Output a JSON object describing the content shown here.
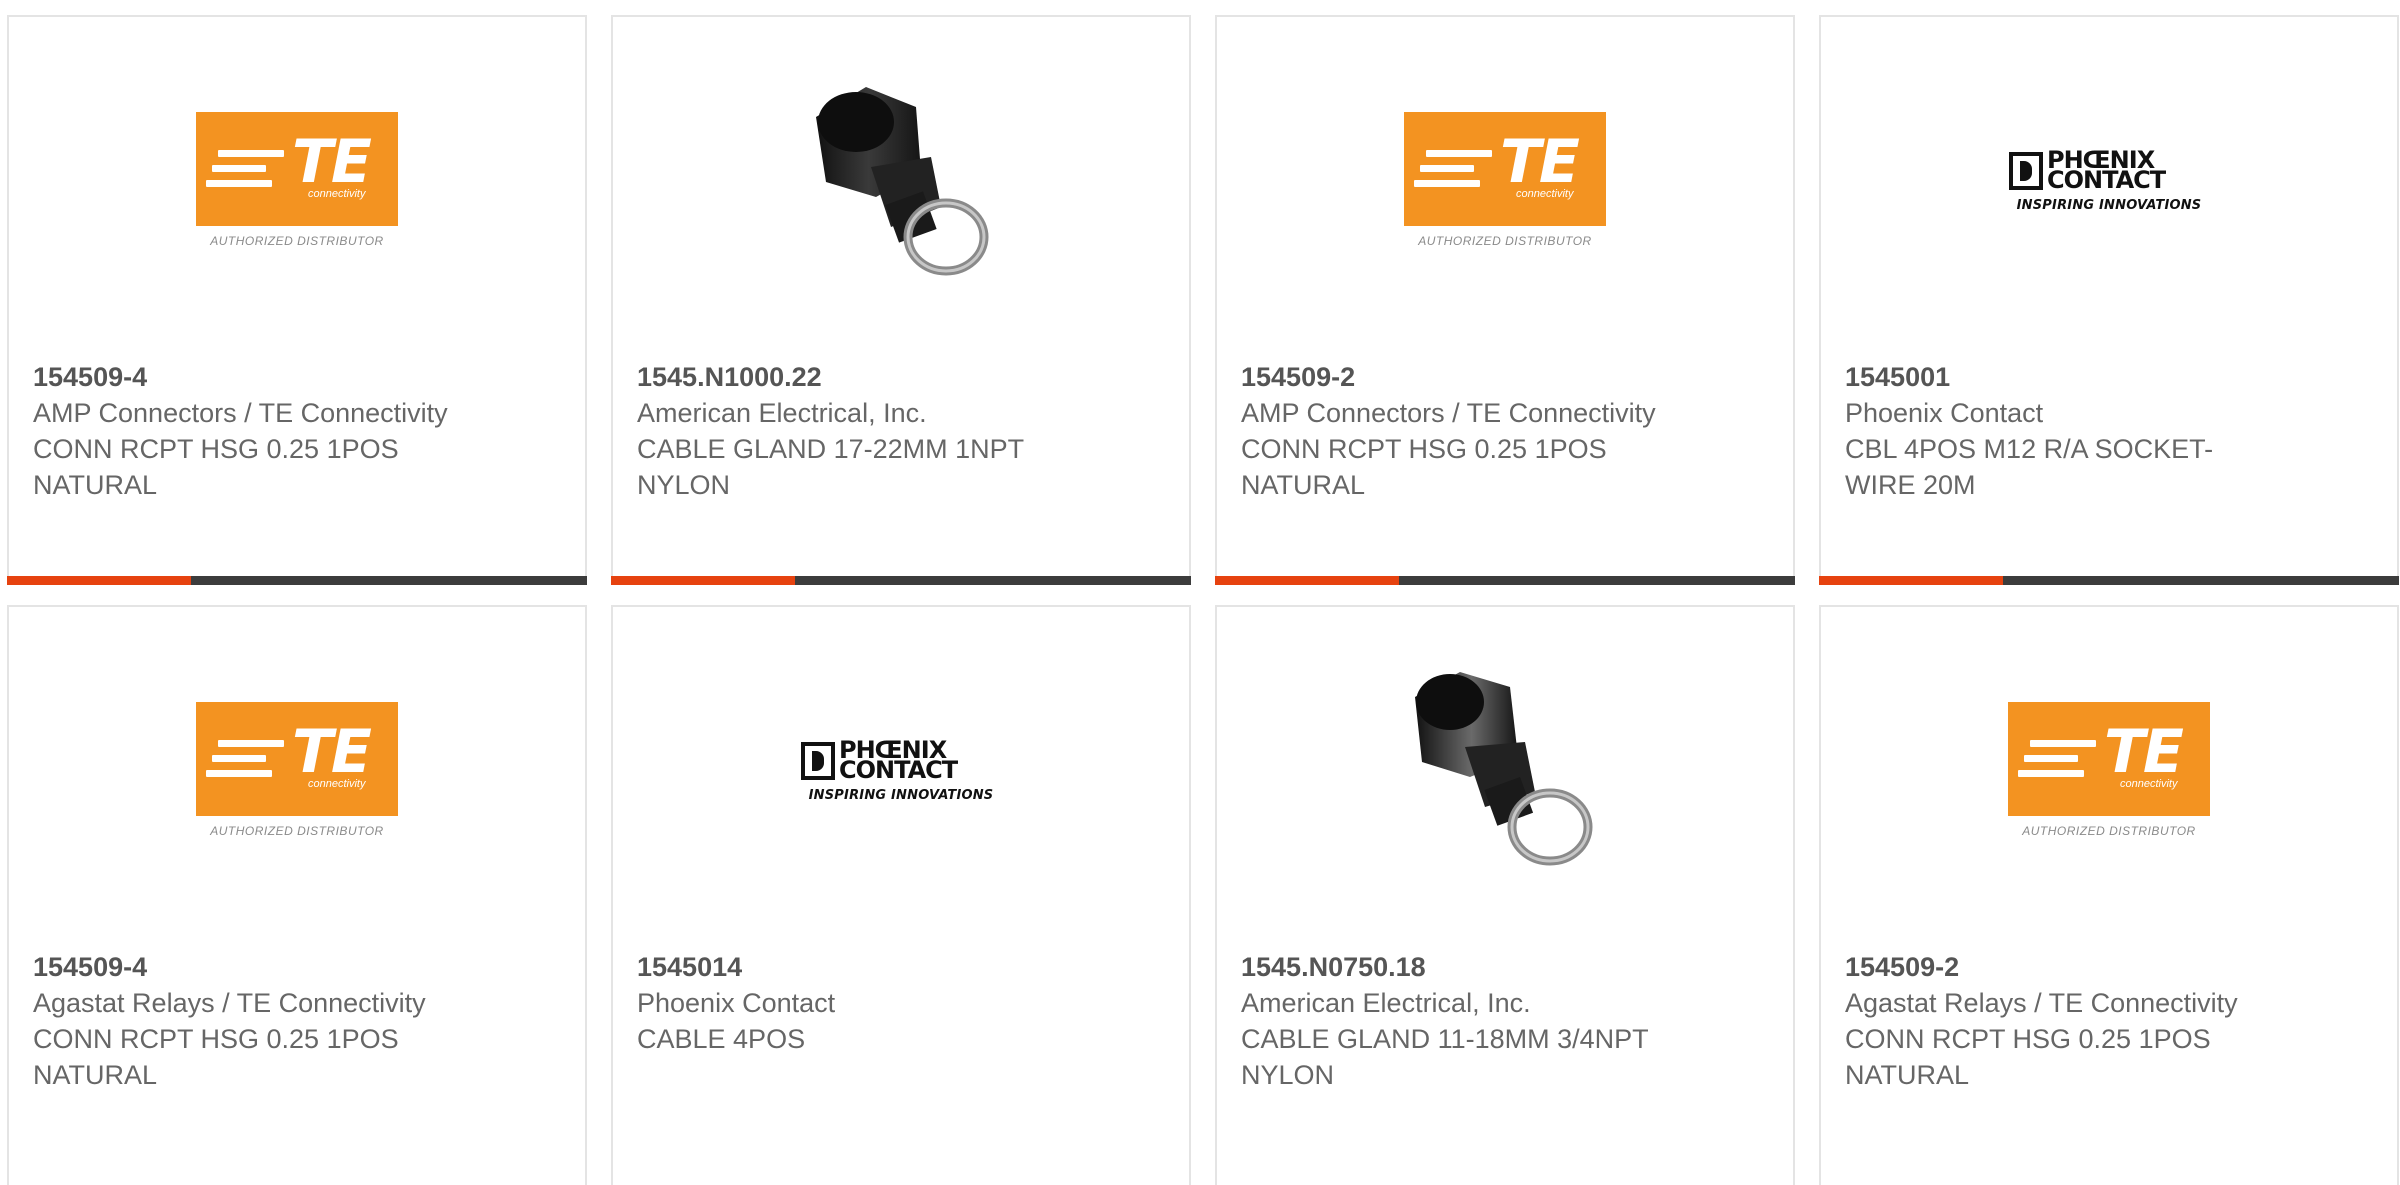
{
  "products": [
    {
      "part_number": "154509-4",
      "manufacturer": "AMP Connectors / TE Connectivity",
      "description": "CONN RCPT HSG 0.25 1POS NATURAL",
      "image": "te-logo"
    },
    {
      "part_number": "1545.N1000.22",
      "manufacturer": "American Electrical, Inc.",
      "description": "CABLE GLAND 17-22MM 1NPT NYLON",
      "image": "cable-gland"
    },
    {
      "part_number": "154509-2",
      "manufacturer": "AMP Connectors / TE Connectivity",
      "description": "CONN RCPT HSG 0.25 1POS NATURAL",
      "image": "te-logo"
    },
    {
      "part_number": "1545001",
      "manufacturer": "Phoenix Contact",
      "description": "CBL 4POS M12 R/A SOCKET-WIRE 20M",
      "image": "phoenix-logo"
    },
    {
      "part_number": "154509-4",
      "manufacturer": "Agastat Relays / TE Connectivity",
      "description": "CONN RCPT HSG 0.25 1POS NATURAL",
      "image": "te-logo"
    },
    {
      "part_number": "1545014",
      "manufacturer": "Phoenix Contact",
      "description": "CABLE 4POS",
      "image": "phoenix-logo"
    },
    {
      "part_number": "1545.N0750.18",
      "manufacturer": "American Electrical, Inc.",
      "description": "CABLE GLAND 11-18MM 3/4NPT NYLON",
      "image": "cable-gland"
    },
    {
      "part_number": "154509-2",
      "manufacturer": "Agastat Relays / TE Connectivity",
      "description": "CONN RCPT HSG 0.25 1POS NATURAL",
      "image": "te-logo"
    }
  ],
  "logos": {
    "te": {
      "letters": "TE",
      "sub": "connectivity",
      "caption": "AUTHORIZED DISTRIBUTOR"
    },
    "phoenix": {
      "line1": "PHŒNIX",
      "line2": "CONTACT",
      "tagline": "INSPIRING INNOVATIONS"
    }
  },
  "colors": {
    "accent": "#e6420f",
    "bar": "#3c3c3c",
    "te_orange": "#f39321",
    "text": "#666666"
  }
}
